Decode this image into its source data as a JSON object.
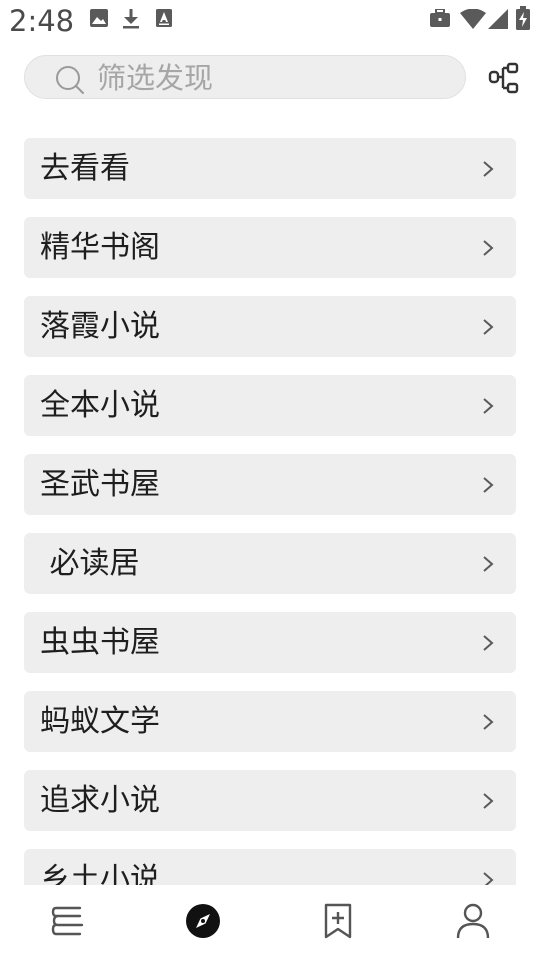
{
  "status_bar": {
    "time": "2:48",
    "left_icons": [
      "image-icon",
      "download-icon",
      "a-box-icon"
    ],
    "right_icons": [
      "briefcase-icon",
      "wifi-icon",
      "signal-icon",
      "battery-charging-icon"
    ]
  },
  "search": {
    "placeholder": "筛选发现",
    "icon": "search-icon"
  },
  "toolbar": {
    "filter_icon": "tree-structure-icon"
  },
  "list": {
    "items": [
      {
        "label": "去看看"
      },
      {
        "label": "精华书阁"
      },
      {
        "label": "落霞小说"
      },
      {
        "label": "全本小说"
      },
      {
        "label": "圣武书屋"
      },
      {
        "label": " 必读居"
      },
      {
        "label": "虫虫书屋"
      },
      {
        "label": "蚂蚁文学"
      },
      {
        "label": "追求小说"
      },
      {
        "label": "乡土小说"
      }
    ],
    "chevron_icon": "chevron-right-icon"
  },
  "bottom_nav": {
    "items": [
      {
        "icon": "bookshelf-icon",
        "active": false
      },
      {
        "icon": "compass-icon",
        "active": true
      },
      {
        "icon": "bookmark-add-icon",
        "active": false
      },
      {
        "icon": "person-icon",
        "active": false
      }
    ]
  },
  "colors": {
    "background": "#ffffff",
    "item_background": "#eeeeee",
    "text": "#1e1e1e",
    "placeholder": "#a6a6a6",
    "icon": "#555555",
    "active_icon": "#111111"
  }
}
